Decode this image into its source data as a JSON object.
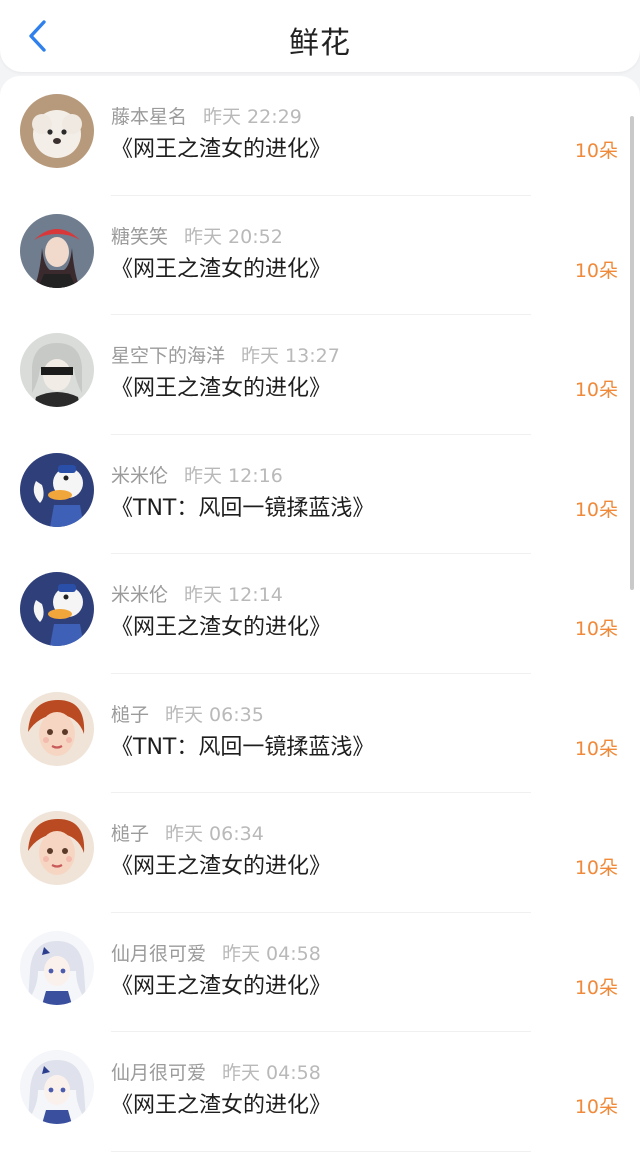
{
  "header": {
    "title": "鲜花",
    "back_icon": "chevron-left-icon"
  },
  "colors": {
    "accent": "#2f80ed",
    "amount": "#f08a3a"
  },
  "items": [
    {
      "name": "藤本星名",
      "time": "昨天 22:29",
      "book": "《网王之渣女的进化》",
      "amount": "10朵",
      "avatar": "poodle"
    },
    {
      "name": "糖笑笑",
      "time": "昨天 20:52",
      "book": "《网王之渣女的进化》",
      "amount": "10朵",
      "avatar": "girl-red-hat"
    },
    {
      "name": "星空下的海洋",
      "time": "昨天 13:27",
      "book": "《网王之渣女的进化》",
      "amount": "10朵",
      "avatar": "blindfold-anime"
    },
    {
      "name": "米米伦",
      "time": "昨天 12:16",
      "book": "《TNT：风回一镜揉蓝浅》",
      "amount": "10朵",
      "avatar": "donald-duck"
    },
    {
      "name": "米米伦",
      "time": "昨天 12:14",
      "book": "《网王之渣女的进化》",
      "amount": "10朵",
      "avatar": "donald-duck"
    },
    {
      "name": "槌子",
      "time": "昨天 06:35",
      "book": "《TNT：风回一镜揉蓝浅》",
      "amount": "10朵",
      "avatar": "painted-girl"
    },
    {
      "name": "槌子",
      "time": "昨天 06:34",
      "book": "《网王之渣女的进化》",
      "amount": "10朵",
      "avatar": "painted-girl"
    },
    {
      "name": "仙月很可爱",
      "time": "昨天 04:58",
      "book": "《网王之渣女的进化》",
      "amount": "10朵",
      "avatar": "anime-white-hair"
    },
    {
      "name": "仙月很可爱",
      "time": "昨天 04:58",
      "book": "《网王之渣女的进化》",
      "amount": "10朵",
      "avatar": "anime-white-hair"
    }
  ]
}
